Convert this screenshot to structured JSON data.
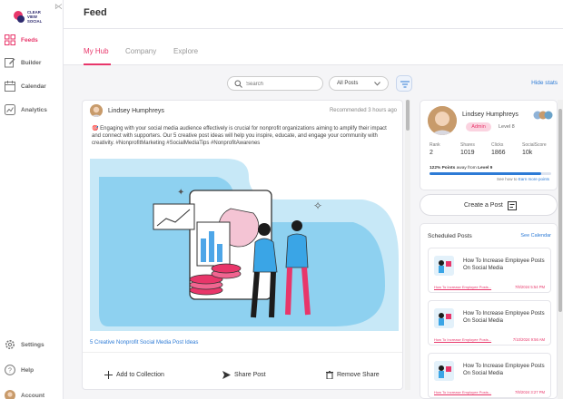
{
  "brand": {
    "logo_text_1": "CLEAR",
    "logo_text_2": "VIEW",
    "logo_text_3": "SOCIAL",
    "accent": "#e8366a",
    "link": "#2d7bd6"
  },
  "sidebar": {
    "items": [
      {
        "label": "Feeds",
        "icon": "grid-icon",
        "active": true
      },
      {
        "label": "Builder",
        "icon": "edit-icon",
        "active": false
      },
      {
        "label": "Calendar",
        "icon": "calendar-icon",
        "active": false
      },
      {
        "label": "Analytics",
        "icon": "analytics-icon",
        "active": false
      }
    ],
    "bottom": [
      {
        "label": "Settings",
        "icon": "gear-icon"
      },
      {
        "label": "Help",
        "icon": "help-icon"
      },
      {
        "label": "Account",
        "icon": "avatar"
      }
    ]
  },
  "header": {
    "title": "Feed"
  },
  "tabs": [
    {
      "label": "My Hub",
      "active": true
    },
    {
      "label": "Company",
      "active": false
    },
    {
      "label": "Explore",
      "active": false
    }
  ],
  "filters": {
    "search_placeholder": "Search",
    "select_value": "All Posts",
    "hide_stats": "Hide stats"
  },
  "post": {
    "author": "Lindsey Humphreys",
    "meta": "Recommended 3 hours ago",
    "text": "🎯 Engaging with your social media audience effectively is crucial for nonprofit organizations aiming to amplify their impact and connect with supporters. Our 5 creative post ideas will help you inspire, educate, and engage your community with creativity. #NonprofitMarketing #SocialMediaTips #NonprofitAwarenes",
    "link": "5 Creative Nonprofit Social Media Post Ideas",
    "actions": {
      "add": "Add to Collection",
      "share": "Share Post",
      "remove": "Remove Share"
    }
  },
  "profile": {
    "name": "Lindsey Humphreys",
    "role": "Admin",
    "level": "Level 8",
    "stats": [
      {
        "key": "Rank",
        "value": "2"
      },
      {
        "key": "Shares",
        "value": "1019"
      },
      {
        "key": "Clicks",
        "value": "1866"
      },
      {
        "key": "SocialScore",
        "value": "10k"
      }
    ],
    "points_bold": "122% Points",
    "points_text": " away from ",
    "points_level": "Level 9",
    "progress": 0.92,
    "earn_text": "See how to ",
    "earn_link": "Earn more points"
  },
  "create_post": {
    "label": "Create a Post"
  },
  "scheduled": {
    "title": "Scheduled Posts",
    "see_calendar": "See Calendar",
    "items": [
      {
        "title": "How To Increase Employee Posts On Social Media",
        "link": "How To Increase Employee Posts...",
        "date": "7/8/2024 5:54 PM"
      },
      {
        "title": "How To Increase Employee Posts On Social Media",
        "link": "How To Increase Employee Posts...",
        "date": "7/10/2024 9:56 AM"
      },
      {
        "title": "How To Increase Employee Posts On Social Media",
        "link": "How To Increase Employee Posts...",
        "date": "7/8/2024 3:27 PM"
      }
    ]
  }
}
